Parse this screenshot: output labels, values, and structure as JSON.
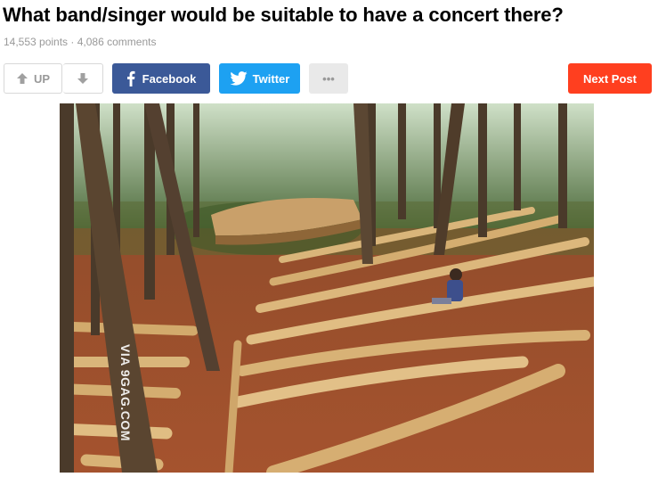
{
  "post": {
    "title": "What band/singer would be suitable to have a concert there?",
    "points": "14,553 points",
    "separator": " · ",
    "comments": "4,086 comments"
  },
  "actions": {
    "upvote_label": "UP",
    "facebook_label": "Facebook",
    "twitter_label": "Twitter",
    "more_label": "•••",
    "next_label": "Next Post"
  },
  "image": {
    "watermark": "VIA 9GAG.COM"
  },
  "colors": {
    "facebook": "#3b5998",
    "twitter": "#1da1f2",
    "next": "#ff3f1f",
    "meta": "#999999"
  },
  "icons": [
    "arrow-up-icon",
    "arrow-down-icon",
    "facebook-icon",
    "twitter-icon"
  ]
}
